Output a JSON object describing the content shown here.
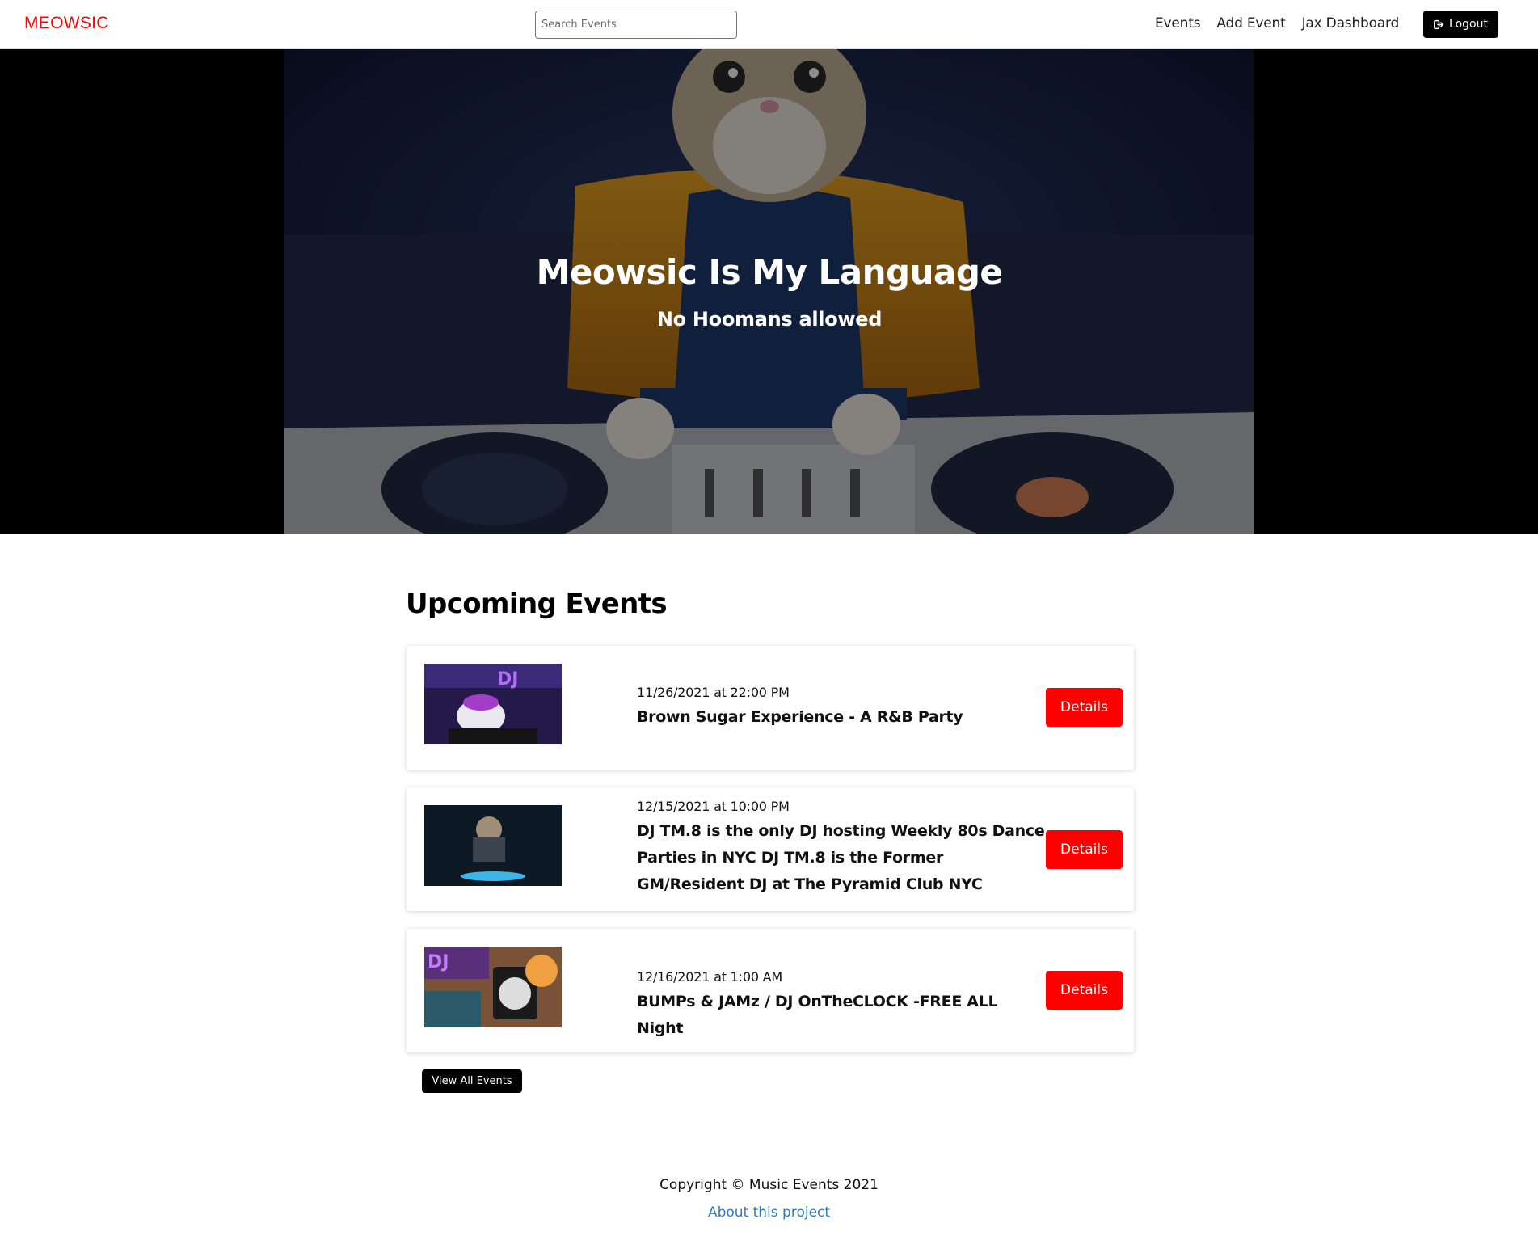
{
  "navbar": {
    "brand": "MEOWSIC",
    "search_placeholder": "Search Events",
    "links": [
      "Events",
      "Add Event",
      "Jax Dashboard"
    ],
    "logout_label": "Logout"
  },
  "hero": {
    "title": "Meowsic Is My Language",
    "subtitle": "No Hoomans allowed"
  },
  "events_section": {
    "title": "Upcoming Events",
    "events": [
      {
        "date": "11/26/2021 at 22:00 PM",
        "name": "Brown Sugar Experience - A R&B Party",
        "button": "Details"
      },
      {
        "date": "12/15/2021 at 10:00 PM",
        "name": "DJ TM.8 is the only DJ hosting Weekly 80s Dance Parties in NYC DJ TM.8 is the Former GM/Resident DJ at The Pyramid Club NYC",
        "button": "Details"
      },
      {
        "date": "12/16/2021 at 1:00 AM",
        "name": "BUMPs & JAMz / DJ OnTheCLOCK -FREE ALL Night",
        "button": "Details"
      }
    ],
    "view_all_label": "View All Events"
  },
  "footer": {
    "copyright": "Copyright © Music Events 2021",
    "about_link": "About this project"
  },
  "colors": {
    "brand": "#ff0000",
    "details_button": "#ff0000",
    "dark_button": "#000000",
    "link": "#337ab7"
  },
  "icons": {
    "logout": "sign-out-icon"
  }
}
